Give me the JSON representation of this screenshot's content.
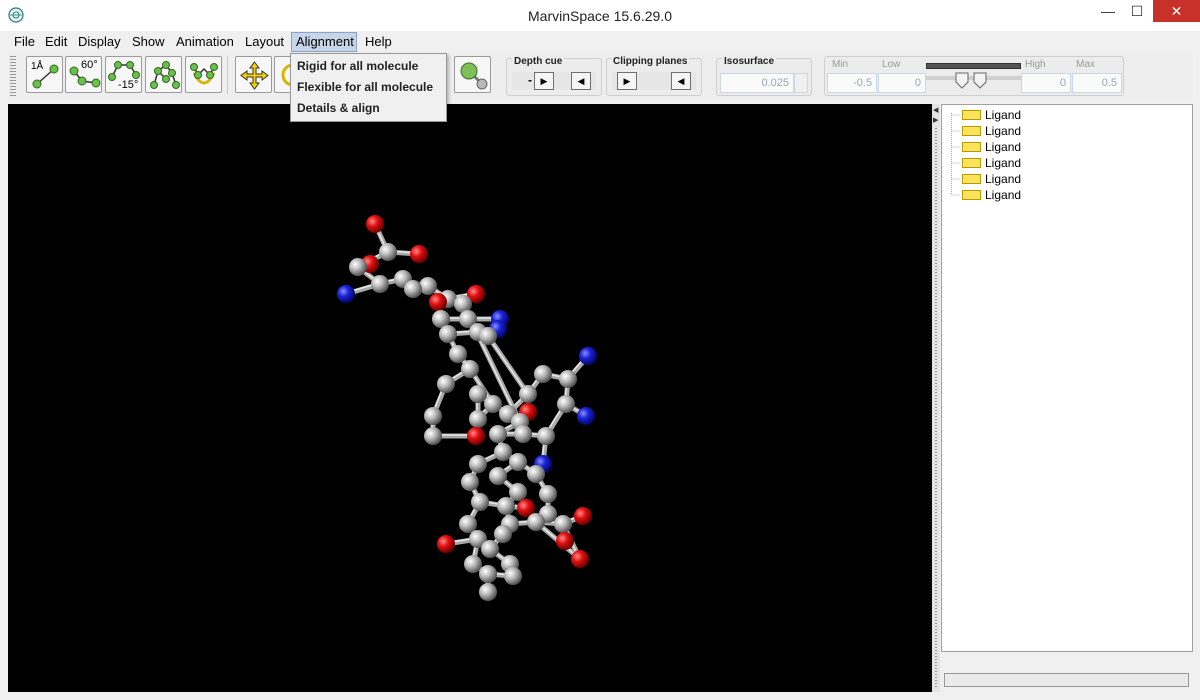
{
  "window": {
    "title": "MarvinSpace 15.6.29.0"
  },
  "window_controls": {
    "minimize": "—",
    "maximize": "☐",
    "close": "✕"
  },
  "menu": [
    "File",
    "Edit",
    "Display",
    "Show",
    "Animation",
    "Layout",
    "Alignment",
    "Help"
  ],
  "toolbar": {
    "buttons": [
      {
        "name": "measure-distance",
        "label": "1Å"
      },
      {
        "name": "measure-angle",
        "label": "60°"
      },
      {
        "name": "measure-dihedral",
        "label": "-15°"
      },
      {
        "name": "select-fragment",
        "label": ""
      },
      {
        "name": "select-ring",
        "label": ""
      },
      {
        "name": "translate",
        "label": ""
      },
      {
        "name": "rotate",
        "label": ""
      },
      {
        "name": "ball-stick",
        "label": ""
      }
    ],
    "depth_cue": {
      "label": "Depth cue",
      "minus": "-",
      "right": "▶",
      "left": "◀"
    },
    "clipping_planes": {
      "label": "Clipping planes",
      "right": "▶",
      "left": "◀"
    },
    "isosurface": {
      "label": "Isosurface",
      "value": "0.025"
    },
    "range": {
      "min_label": "Min",
      "low_label": "Low",
      "high_label": "High",
      "max_label": "Max",
      "min_value": "-0.5",
      "low_value": "0",
      "high_value": "0",
      "max_value": "0.5"
    }
  },
  "alignment_menu": {
    "items": [
      "Rigid for all molecule",
      "Flexible for all molecule",
      "Details & align"
    ]
  },
  "tree": {
    "items": [
      "Ligand",
      "Ligand",
      "Ligand",
      "Ligand",
      "Ligand",
      "Ligand"
    ]
  },
  "colors": {
    "carbon": "#bdbdbd",
    "oxygen": "#e01010",
    "nitrogen": "#1a22d8",
    "viewport_bg": "#000000",
    "folder": "#f9e35b",
    "close_button": "#c7312a"
  }
}
